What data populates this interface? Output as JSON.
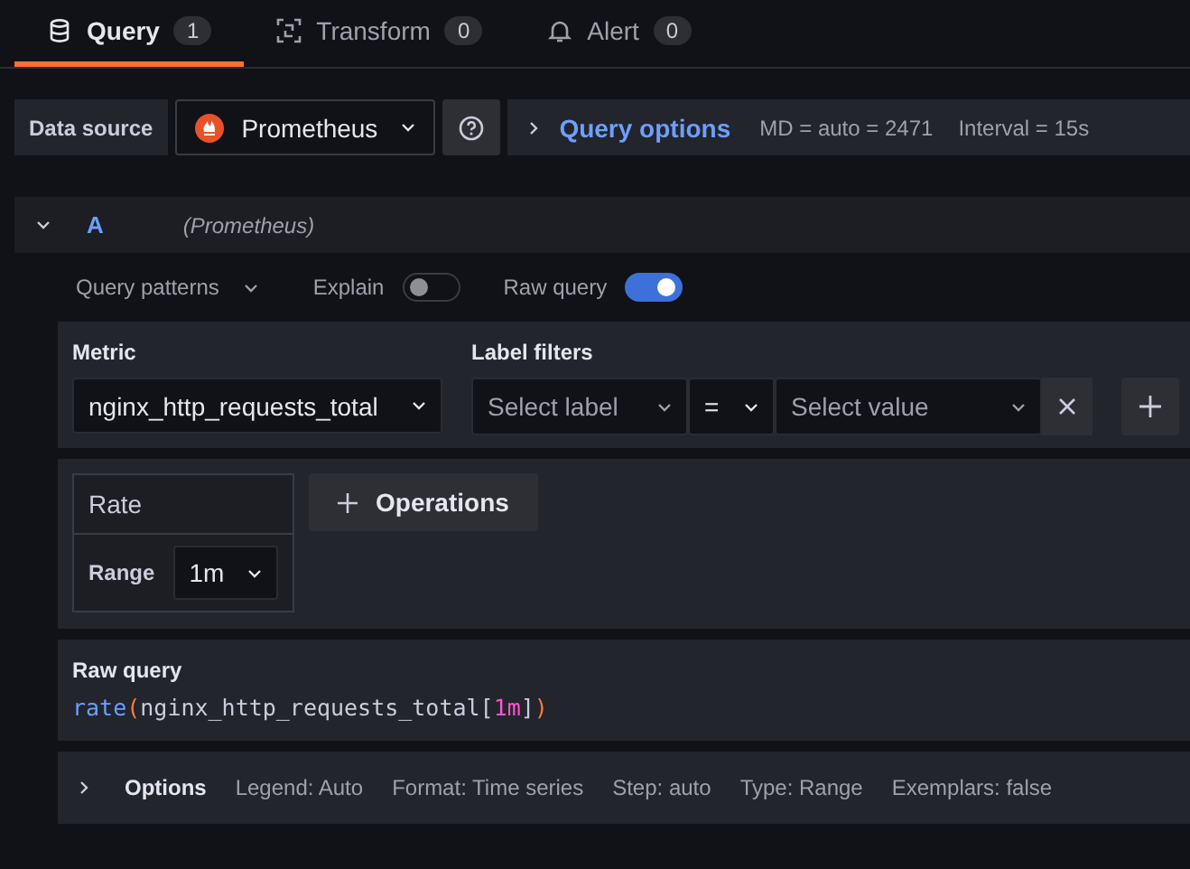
{
  "tabs": [
    {
      "label": "Query",
      "count": "1",
      "kind": "database",
      "selected": true
    },
    {
      "label": "Transform",
      "count": "0",
      "kind": "transform",
      "selected": false
    },
    {
      "label": "Alert",
      "count": "0",
      "kind": "alert",
      "selected": false
    }
  ],
  "toolbar": {
    "data_source_label": "Data source",
    "data_source": "Prometheus",
    "query_options": "Query options",
    "md": "MD = auto = 2471",
    "interval": "Interval = 15s"
  },
  "query": {
    "ref": "A",
    "source": "(Prometheus)",
    "expanded": true,
    "patterns": "Query patterns",
    "explain": {
      "label": "Explain",
      "on": false
    },
    "raw_query_toggle": {
      "label": "Raw query",
      "on": true
    },
    "metric": {
      "label": "Metric",
      "value": "nginx_http_requests_total"
    },
    "label_filters": {
      "label": "Label filters",
      "label_placeholder": "Select label",
      "operator": "=",
      "value_placeholder": "Select value"
    },
    "operation": {
      "name": "Rate",
      "param_label": "Range",
      "param_value": "1m"
    },
    "operations_button": "Operations",
    "raw_query": {
      "label": "Raw query",
      "tokens": [
        {
          "text": "rate",
          "kind": "function"
        },
        {
          "text": "(",
          "kind": "paren"
        },
        {
          "text": "nginx_http_requests_total",
          "kind": "metric"
        },
        {
          "text": "[",
          "kind": "bracket"
        },
        {
          "text": "1m",
          "kind": "duration"
        },
        {
          "text": "]",
          "kind": "bracket"
        },
        {
          "text": ")",
          "kind": "paren"
        }
      ]
    },
    "options": {
      "label": "Options",
      "items": [
        "Legend: Auto",
        "Format: Time series",
        "Step: auto",
        "Type: Range",
        "Exemplars: false"
      ]
    }
  }
}
